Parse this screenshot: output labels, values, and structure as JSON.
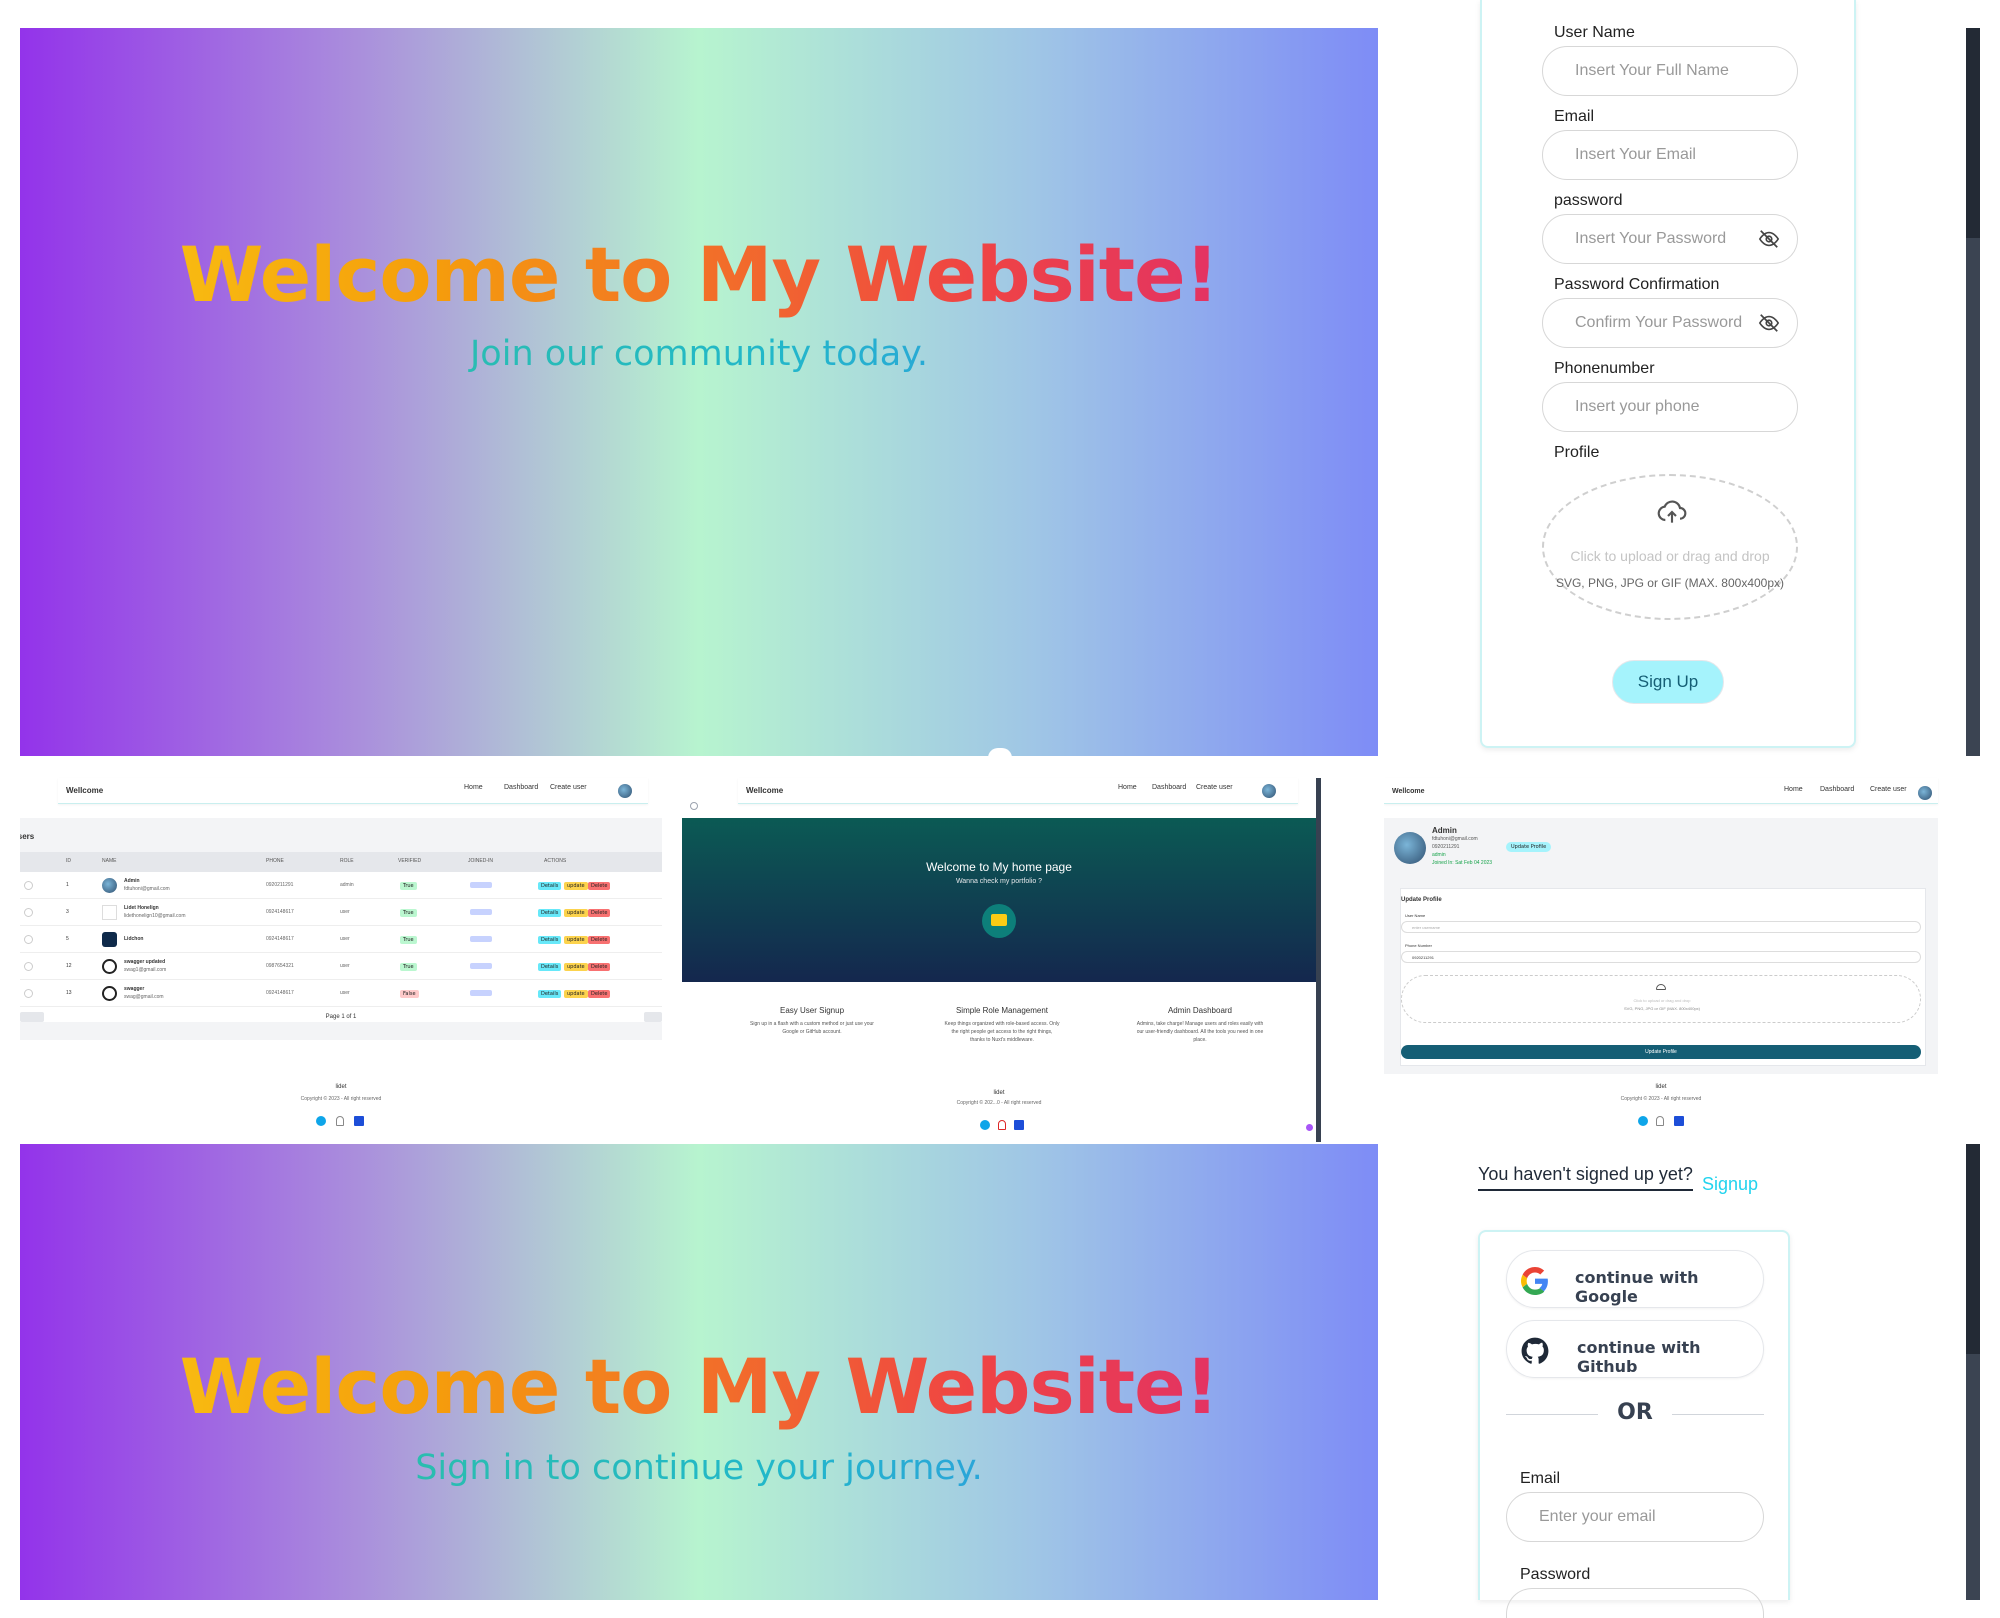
{
  "signup_panel": {
    "hero_title": "Welcome to My Website!",
    "hero_subtitle": "Join our community today.",
    "form": {
      "username_label": "User Name",
      "username_placeholder": "Insert Your Full Name",
      "email_label": "Email",
      "email_placeholder": "Insert Your Email",
      "password_label": "password",
      "password_placeholder": "Insert Your Password",
      "confirm_label": "Password Confirmation",
      "confirm_placeholder": "Confirm Your Password",
      "phone_label": "Phonenumber",
      "phone_placeholder": "Insert your phone",
      "profile_label": "Profile",
      "upload_text_1": "Click to upload",
      "upload_text_2": " or drag and drop",
      "upload_hint": "SVG, PNG, JPG or GIF (MAX. 800x400px)",
      "submit_label": "Sign Up"
    }
  },
  "dashboard_panel": {
    "brand": "Wellcome",
    "nav": [
      "Home",
      "Dashboard",
      "Create user"
    ],
    "section_title": "Users",
    "columns": [
      "ID",
      "NAME",
      "PHONE",
      "ROLE",
      "VERIFIED",
      "JOINED-IN",
      "ACTIONS"
    ],
    "rows": [
      {
        "id": "1",
        "name": "Admin",
        "email": "fdtuhoni@gmail.com",
        "phone": "0920211291",
        "role": "admin",
        "verified": "True"
      },
      {
        "id": "3",
        "name": "Lidet Honelign",
        "email": "lidethonelign10@gmail.com",
        "phone": "0924148617",
        "role": "user",
        "verified": "True"
      },
      {
        "id": "5",
        "name": "Lidchon",
        "email": "",
        "phone": "0924148617",
        "role": "user",
        "verified": "True"
      },
      {
        "id": "12",
        "name": "swagger updated",
        "email": "swag1@gmail.com",
        "phone": "0987654321",
        "role": "user",
        "verified": "True"
      },
      {
        "id": "13",
        "name": "swagger",
        "email": "swag@gmail.com",
        "phone": "0924148617",
        "role": "user",
        "verified": "False"
      }
    ],
    "actions": [
      "Details",
      "update",
      "Delete"
    ],
    "pagination": "Page 1 of 1",
    "footer_brand": "lidet",
    "footer_copy": "Copyright © 2023 - All right reserved"
  },
  "home_panel": {
    "brand": "Wellcome",
    "nav": [
      "Home",
      "Dashboard",
      "Create user"
    ],
    "hero_title": "Welcome to My home page",
    "hero_sub": "Wanna check my portfolio ?",
    "features": [
      {
        "title": "Easy User Signup",
        "text": "Sign up in a flash with a custom method or just use your Google or GitHub account."
      },
      {
        "title": "Simple Role Management",
        "text": "Keep things organized with role-based access. Only the right people get access to the right things, thanks to Nuxt's middleware."
      },
      {
        "title": "Admin Dashboard",
        "text": "Admins, take charge! Manage users and roles easily with our user-friendly dashboard. All the tools you need in one place."
      }
    ],
    "footer_brand": "lidet",
    "footer_copy": "Copyright © 202...0 - All right reserved"
  },
  "profile_panel": {
    "brand": "Wellcome",
    "nav": [
      "Home",
      "Dashboard",
      "Create user"
    ],
    "name": "Admin",
    "email": "fdtuhoni@gmail.com",
    "phone": "0920211291",
    "role": "admin",
    "joined": "Joined In: Sat Feb 04 2023",
    "update_badge": "Update Profile",
    "section_title": "Update Profile",
    "username_label": "User Name",
    "username_placeholder": "enter username",
    "phone_label": "Phone Number",
    "phone_value": "0920211291",
    "upload_text": "Click to upload or drag and drop",
    "upload_hint": "SVG, PNG, JPG or GIF (MAX. 800x400px)",
    "submit_label": "Update Profile",
    "footer_brand": "lidet",
    "footer_copy": "Copyright © 2023 - All right reserved"
  },
  "signin_panel": {
    "hero_title": "Welcome to My Website!",
    "hero_subtitle": "Sign in to continue your journey.",
    "prompt": "You haven't signed up yet?",
    "signup_link": "Signup",
    "google_label": "continue with Google",
    "github_label": "continue with Github",
    "or_label": "OR",
    "email_label": "Email",
    "email_placeholder": "Enter your email",
    "password_label": "Password"
  },
  "colors": {
    "accent_teal": "#22d3ee",
    "dark_teal": "#155e75",
    "verified_true": "#bbf7d0",
    "verified_false": "#fecaca",
    "details": "#67e8f9",
    "update": "#fcd34d",
    "delete": "#f87171"
  }
}
